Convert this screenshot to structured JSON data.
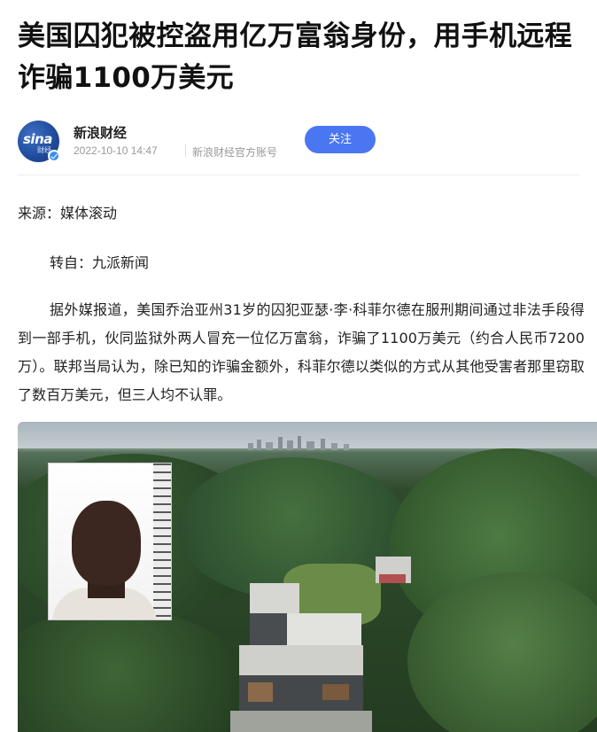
{
  "article": {
    "title": "美国囚犯被控盗用亿万富翁身份，用手机远程诈骗1100万美元"
  },
  "author": {
    "logo_text": "sina",
    "logo_sub": "财经",
    "name": "新浪财经",
    "time": "2022-10-10 14:47",
    "account_tag": "新浪财经官方账号",
    "follow_label": "关注"
  },
  "content": {
    "source": "来源：媒体滚动",
    "transfer": "转自：九派新闻",
    "paragraph": "据外媒报道，美国乔治亚州31岁的囚犯亚瑟·李·科菲尔德在服刑期间通过非法手段得到一部手机，伙同监狱外两人冒充一位亿万富翁，诈骗了1100万美元（约合人民币7200万）。联邦当局认为，除已知的诈骗金额外，科菲尔德以类似的方式从其他受害者那里窃取了数百万美元，但三人均不认罪。"
  },
  "colors": {
    "follow_button": "#4a76f2",
    "meta_text": "#999999"
  }
}
